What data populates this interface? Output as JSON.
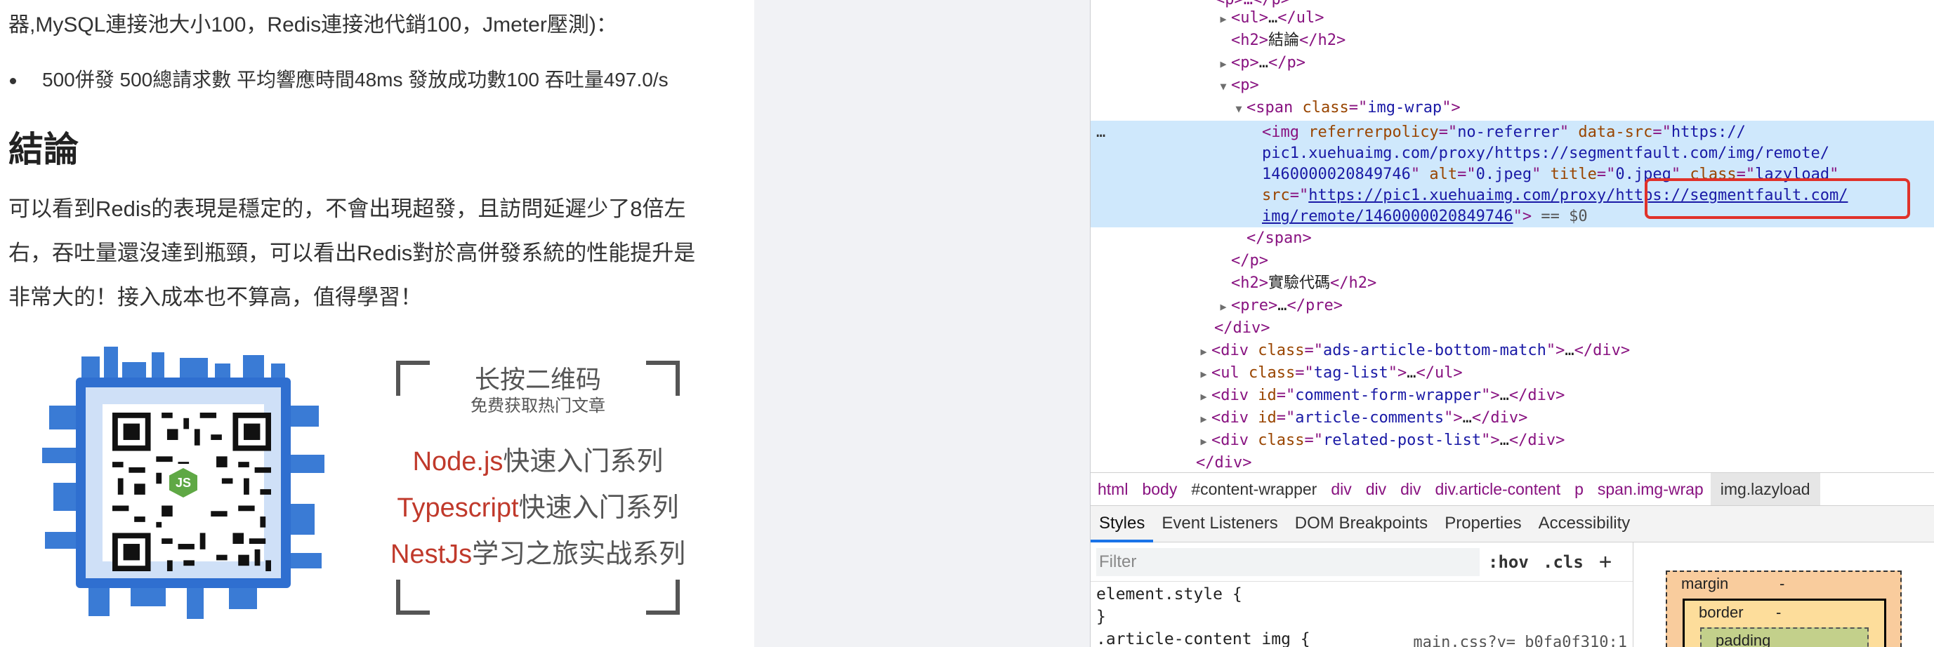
{
  "article": {
    "line1": "器,MySQL連接池大小100，Redis連接池代銷100，Jmeter壓測)：",
    "bullet": "500併發 500總請求數 平均響應時間48ms 發放成功數100 吞吐量497.0/s",
    "heading": "結論",
    "paragraph_lines": [
      "可以看到Redis的表現是穩定的，不會出現超發，且訪問延遲少了8倍左",
      "右，吞吐量還沒達到瓶頸，可以看出Redis對於高併發系統的性能提升是",
      "非常大的！接入成本也不算高，值得學習！"
    ],
    "promo": {
      "title": "长按二维码",
      "subtitle": "免费获取热门文章",
      "items": [
        {
          "hl": "Node.js",
          "rest": "快速入门系列"
        },
        {
          "hl": "Typescript",
          "rest": "快速入门系列"
        },
        {
          "hl": "NestJs",
          "rest": "学习之旅实战系列"
        }
      ],
      "qr_center": "JS"
    }
  },
  "devtools": {
    "elements": {
      "r0": "<p>…</p>",
      "r1_tag": "ul",
      "r1_text": "…",
      "r2_tag": "h2",
      "r2_text": "結論",
      "r3_tag": "p",
      "r3_text": "…",
      "r4_tag": "p",
      "r5_tag": "span",
      "r5_attr": "class",
      "r5_val": "img-wrap",
      "img_tag": "img",
      "img_attr1": "referrerpolicy",
      "img_val1": "no-referrer",
      "img_attr2": "data-src",
      "img_val2a": "https://",
      "img_val2b": "pic1.xuehuaimg.com/proxy/https://segmentfault.com/img/remote/",
      "img_val2c": "1460000020849746",
      "img_attr3": "alt",
      "img_val3": "0.jpeg",
      "img_attr4": "title",
      "img_val4": "0.jpeg",
      "img_attr5": "class",
      "img_val5": "lazyload",
      "img_attr6": "src",
      "img_src1": "https://pic1.xuehuaimg.com/proxy/https://segmentfault.com/",
      "img_src2": "img/remote/1460000020849746",
      "img_suffix": "== $0",
      "close_span": "</span>",
      "close_p": "</p>",
      "r_h2_tag": "h2",
      "r_h2_text": "實驗代碼",
      "r_pre_tag": "pre",
      "r_pre_text": "…",
      "close_div": "</div>",
      "div1_attr": "class",
      "div1_val": "ads-article-bottom-match",
      "ul2_attr": "class",
      "ul2_val": "tag-list",
      "div2_attr": "id",
      "div2_val": "comment-form-wrapper",
      "div3_attr": "id",
      "div3_val": "article-comments",
      "div4_attr": "class",
      "div4_val": "related-post-list",
      "close_div2": "</div>",
      "ellipsis": "…"
    },
    "breadcrumbs": [
      "html",
      "body",
      "#content-wrapper",
      "div",
      "div",
      "div",
      "div.article-content",
      "p",
      "span.img-wrap",
      "img.lazyload"
    ],
    "tabs": [
      "Styles",
      "Event Listeners",
      "DOM Breakpoints",
      "Properties",
      "Accessibility"
    ],
    "filter_placeholder": "Filter",
    "hov": ":hov",
    "cls": ".cls",
    "plus": "+",
    "style_line1": "element.style {",
    "style_line2": "}",
    "style_line3": ".article-content img {",
    "style_src": "main.css?v=_b0fa0f310:1",
    "box": {
      "margin": "margin",
      "border": "border",
      "padding": "padding",
      "dash": "-"
    }
  }
}
